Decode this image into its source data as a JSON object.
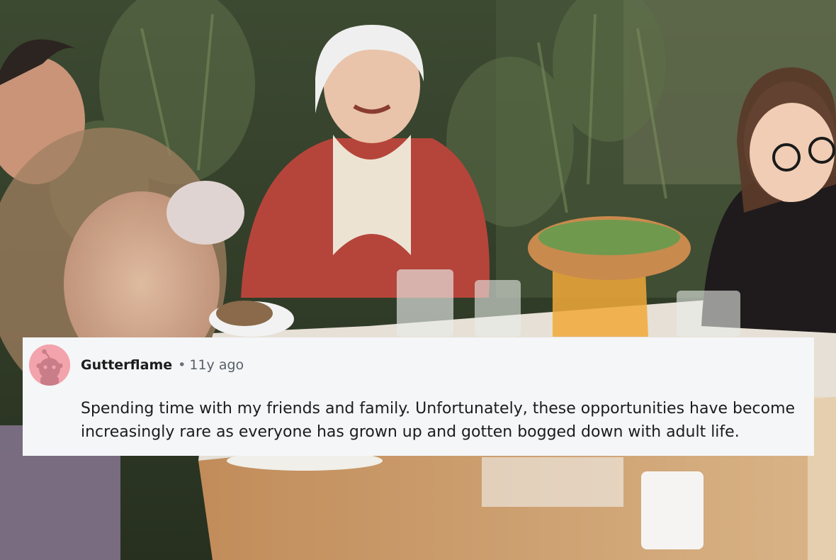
{
  "comment": {
    "username": "Gutterflame",
    "separator": "•",
    "age": "11y ago",
    "body": "Spending time with my friends and family. Unfortunately, these opportunities have become increasingly rare as everyone has grown up and gotten bogged down with adult life.",
    "avatar_icon": "snoo-avatar-icon",
    "avatar_color": "#f2a3ac"
  },
  "background": {
    "icon": "family-dinner-photo",
    "colors": {
      "foliage": "#2f3a28",
      "sweater": "#b5453a",
      "table": "#c99d6a"
    }
  }
}
